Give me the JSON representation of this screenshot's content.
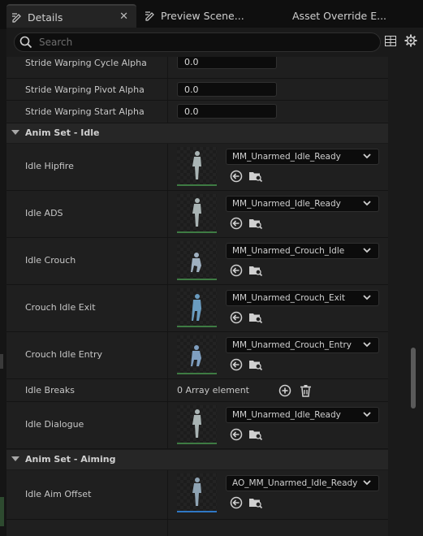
{
  "tabs": [
    {
      "label": "Details",
      "close": "✕"
    },
    {
      "label": "Preview Scene..."
    },
    {
      "label": "Asset Override E..."
    }
  ],
  "search": {
    "placeholder": "Search"
  },
  "top_rows": [
    {
      "label": "Stride Warping Cycle Alpha",
      "value": "0.0"
    },
    {
      "label": "Stride Warping Pivot Alpha",
      "value": "0.0"
    },
    {
      "label": "Stride Warping Start Alpha",
      "value": "0.0"
    }
  ],
  "idle": {
    "title": "Anim Set - Idle",
    "rows": [
      {
        "label": "Idle Hipfire",
        "asset": "MM_Unarmed_Idle_Ready"
      },
      {
        "label": "Idle ADS",
        "asset": "MM_Unarmed_Idle_Ready"
      },
      {
        "label": "Idle Crouch",
        "asset": "MM_Unarmed_Crouch_Idle"
      },
      {
        "label": "Crouch Idle Exit",
        "asset": "MM_Unarmed_Crouch_Exit"
      },
      {
        "label": "Crouch Idle Entry",
        "asset": "MM_Unarmed_Crouch_Entry"
      }
    ],
    "breaks": {
      "label": "Idle Breaks",
      "value": "0 Array element"
    },
    "dialogue": {
      "label": "Idle Dialogue",
      "asset": "MM_Unarmed_Idle_Ready"
    }
  },
  "aiming": {
    "title": "Anim Set - Aiming",
    "rows": [
      {
        "label": "Idle Aim Offset",
        "asset": "AO_MM_Unarmed_Idle_Ready"
      }
    ]
  },
  "colors": {
    "accent_green": "#3e7b43",
    "accent_blue": "#2f78c5"
  }
}
